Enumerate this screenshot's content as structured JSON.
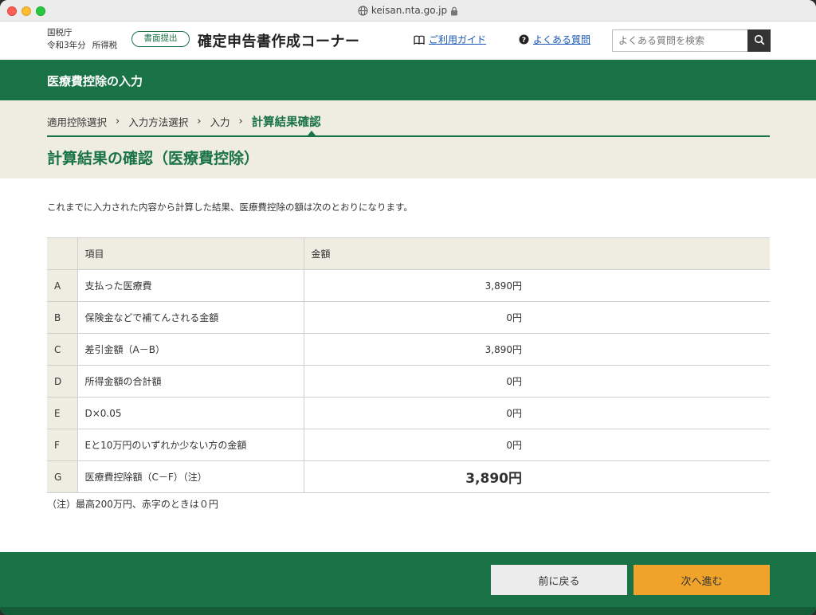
{
  "browser": {
    "url": "keisan.nta.go.jp"
  },
  "header": {
    "org_name": "国税庁",
    "fiscal_year": "令和3年分",
    "tax_type": "所得税",
    "mode_badge": "書面提出",
    "site_title": "確定申告書作成コーナー",
    "guide_link": "ご利用ガイド",
    "faq_link": "よくある質問",
    "search_placeholder": "よくある質問を検索"
  },
  "section": {
    "title": "医療費控除の入力"
  },
  "steps": [
    {
      "label": "適用控除選択"
    },
    {
      "label": "入力方法選択"
    },
    {
      "label": "入力"
    },
    {
      "label": "計算結果確認",
      "current": true
    }
  ],
  "page": {
    "title": "計算結果の確認（医療費控除）",
    "intro": "これまでに入力された内容から計算した結果、医療費控除の額は次のとおりになります。",
    "note": "（注）最高200万円、赤字のときは０円"
  },
  "table": {
    "headers": {
      "item": "項目",
      "amount": "金額"
    },
    "rows": [
      {
        "key": "A",
        "item": "支払った医療費",
        "amount": "3,890円"
      },
      {
        "key": "B",
        "item": "保険金などで補てんされる金額",
        "amount": "0円"
      },
      {
        "key": "C",
        "item": "差引金額（A－B）",
        "amount": "3,890円"
      },
      {
        "key": "D",
        "item": "所得金額の合計額",
        "amount": "0円"
      },
      {
        "key": "E",
        "item": "D×0.05",
        "amount": "0円"
      },
      {
        "key": "F",
        "item": "Eと10万円のいずれか少ない方の金額",
        "amount": "0円"
      },
      {
        "key": "G",
        "item": "医療費控除額（C－F）（注）",
        "amount": "3,890円"
      }
    ]
  },
  "footer": {
    "back_label": "前に戻る",
    "next_label": "次へ進む"
  },
  "colors": {
    "brand_green": "#1a7346",
    "beige": "#efede1",
    "next_button": "#f0a32a",
    "link": "#1a57b8"
  }
}
